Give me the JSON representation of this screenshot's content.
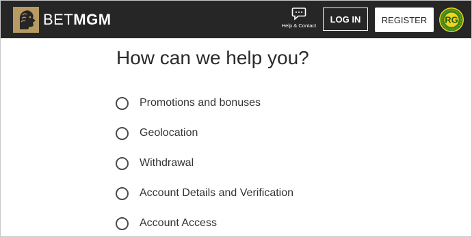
{
  "header": {
    "brand": {
      "part1": "BET",
      "part2": "MGM",
      "icon": "lion-logo-icon"
    },
    "help": {
      "label": "Help & Contact",
      "icon": "chat-icon"
    },
    "login_label": "LOG IN",
    "register_label": "REGISTER",
    "responsible_gaming": {
      "text": "RG",
      "icon": "responsible-gaming-badge-icon"
    }
  },
  "main": {
    "title": "How can we help you?",
    "options": [
      {
        "label": "Promotions and bonuses"
      },
      {
        "label": "Geolocation"
      },
      {
        "label": "Withdrawal"
      },
      {
        "label": "Account Details and Verification"
      },
      {
        "label": "Account Access"
      }
    ]
  },
  "colors": {
    "topbar": "#262626",
    "gold": "#b99a62",
    "rg_green": "#3a8a1f",
    "rg_yellow": "#f2d21b"
  }
}
